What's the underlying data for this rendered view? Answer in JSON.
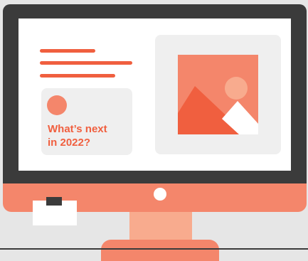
{
  "card": {
    "title_line_1": "What’s next",
    "title_line_2": "in 2022?"
  },
  "colors": {
    "accent": "#f05f3f",
    "accent_light": "#f4866b",
    "accent_pale": "#f8ab8e",
    "bezel": "#3b3b3b",
    "screen": "#ffffff",
    "card_bg": "#efefef",
    "background": "#e6e6e6"
  },
  "icons": {
    "image_placeholder": "image-landscape-icon",
    "avatar": "circle-avatar-icon",
    "power": "power-indicator-icon"
  }
}
